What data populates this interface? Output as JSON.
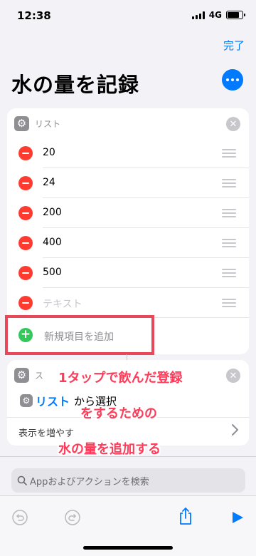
{
  "status_bar": {
    "time": "12:38",
    "network": "4G"
  },
  "nav": {
    "done_label": "完了"
  },
  "page_title": "水の量を記録",
  "list_card": {
    "header_label": "リスト",
    "items": [
      {
        "value": "20"
      },
      {
        "value": "24"
      },
      {
        "value": "200"
      },
      {
        "value": "400"
      },
      {
        "value": "500"
      }
    ],
    "placeholder_item": "テキスト",
    "add_item_label": "新規項目を追加"
  },
  "choose_card": {
    "header_label": "ス",
    "pill_label": "リスト",
    "action_suffix": "から選択",
    "show_more_label": "表示を増やす"
  },
  "annotation": {
    "lines": [
      "1タップで飲んだ登録",
      "をするための",
      "水の量を追加する"
    ],
    "color": "#ff3b59"
  },
  "search": {
    "placeholder": "Appおよびアクションを検索"
  },
  "colors": {
    "accent": "#007aff",
    "delete": "#ff3b30",
    "add": "#34c759",
    "highlight": "#e8495a"
  }
}
